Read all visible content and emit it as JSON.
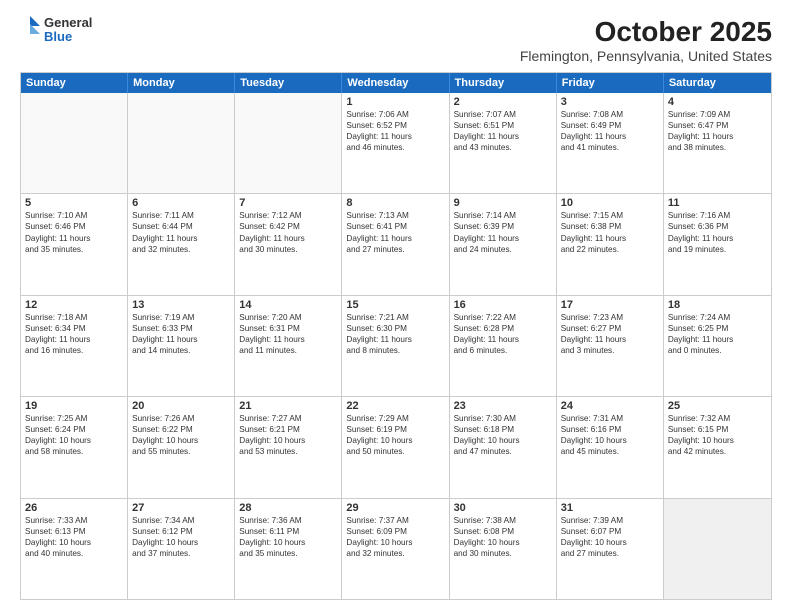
{
  "logo": {
    "general": "General",
    "blue": "Blue"
  },
  "title": "October 2025",
  "subtitle": "Flemington, Pennsylvania, United States",
  "days": [
    "Sunday",
    "Monday",
    "Tuesday",
    "Wednesday",
    "Thursday",
    "Friday",
    "Saturday"
  ],
  "rows": [
    [
      {
        "day": "",
        "empty": true
      },
      {
        "day": "",
        "empty": true
      },
      {
        "day": "",
        "empty": true
      },
      {
        "day": "1",
        "lines": [
          "Sunrise: 7:06 AM",
          "Sunset: 6:52 PM",
          "Daylight: 11 hours",
          "and 46 minutes."
        ]
      },
      {
        "day": "2",
        "lines": [
          "Sunrise: 7:07 AM",
          "Sunset: 6:51 PM",
          "Daylight: 11 hours",
          "and 43 minutes."
        ]
      },
      {
        "day": "3",
        "lines": [
          "Sunrise: 7:08 AM",
          "Sunset: 6:49 PM",
          "Daylight: 11 hours",
          "and 41 minutes."
        ]
      },
      {
        "day": "4",
        "lines": [
          "Sunrise: 7:09 AM",
          "Sunset: 6:47 PM",
          "Daylight: 11 hours",
          "and 38 minutes."
        ]
      }
    ],
    [
      {
        "day": "5",
        "lines": [
          "Sunrise: 7:10 AM",
          "Sunset: 6:46 PM",
          "Daylight: 11 hours",
          "and 35 minutes."
        ]
      },
      {
        "day": "6",
        "lines": [
          "Sunrise: 7:11 AM",
          "Sunset: 6:44 PM",
          "Daylight: 11 hours",
          "and 32 minutes."
        ]
      },
      {
        "day": "7",
        "lines": [
          "Sunrise: 7:12 AM",
          "Sunset: 6:42 PM",
          "Daylight: 11 hours",
          "and 30 minutes."
        ]
      },
      {
        "day": "8",
        "lines": [
          "Sunrise: 7:13 AM",
          "Sunset: 6:41 PM",
          "Daylight: 11 hours",
          "and 27 minutes."
        ]
      },
      {
        "day": "9",
        "lines": [
          "Sunrise: 7:14 AM",
          "Sunset: 6:39 PM",
          "Daylight: 11 hours",
          "and 24 minutes."
        ]
      },
      {
        "day": "10",
        "lines": [
          "Sunrise: 7:15 AM",
          "Sunset: 6:38 PM",
          "Daylight: 11 hours",
          "and 22 minutes."
        ]
      },
      {
        "day": "11",
        "lines": [
          "Sunrise: 7:16 AM",
          "Sunset: 6:36 PM",
          "Daylight: 11 hours",
          "and 19 minutes."
        ]
      }
    ],
    [
      {
        "day": "12",
        "lines": [
          "Sunrise: 7:18 AM",
          "Sunset: 6:34 PM",
          "Daylight: 11 hours",
          "and 16 minutes."
        ]
      },
      {
        "day": "13",
        "lines": [
          "Sunrise: 7:19 AM",
          "Sunset: 6:33 PM",
          "Daylight: 11 hours",
          "and 14 minutes."
        ]
      },
      {
        "day": "14",
        "lines": [
          "Sunrise: 7:20 AM",
          "Sunset: 6:31 PM",
          "Daylight: 11 hours",
          "and 11 minutes."
        ]
      },
      {
        "day": "15",
        "lines": [
          "Sunrise: 7:21 AM",
          "Sunset: 6:30 PM",
          "Daylight: 11 hours",
          "and 8 minutes."
        ]
      },
      {
        "day": "16",
        "lines": [
          "Sunrise: 7:22 AM",
          "Sunset: 6:28 PM",
          "Daylight: 11 hours",
          "and 6 minutes."
        ]
      },
      {
        "day": "17",
        "lines": [
          "Sunrise: 7:23 AM",
          "Sunset: 6:27 PM",
          "Daylight: 11 hours",
          "and 3 minutes."
        ]
      },
      {
        "day": "18",
        "lines": [
          "Sunrise: 7:24 AM",
          "Sunset: 6:25 PM",
          "Daylight: 11 hours",
          "and 0 minutes."
        ]
      }
    ],
    [
      {
        "day": "19",
        "lines": [
          "Sunrise: 7:25 AM",
          "Sunset: 6:24 PM",
          "Daylight: 10 hours",
          "and 58 minutes."
        ]
      },
      {
        "day": "20",
        "lines": [
          "Sunrise: 7:26 AM",
          "Sunset: 6:22 PM",
          "Daylight: 10 hours",
          "and 55 minutes."
        ]
      },
      {
        "day": "21",
        "lines": [
          "Sunrise: 7:27 AM",
          "Sunset: 6:21 PM",
          "Daylight: 10 hours",
          "and 53 minutes."
        ]
      },
      {
        "day": "22",
        "lines": [
          "Sunrise: 7:29 AM",
          "Sunset: 6:19 PM",
          "Daylight: 10 hours",
          "and 50 minutes."
        ]
      },
      {
        "day": "23",
        "lines": [
          "Sunrise: 7:30 AM",
          "Sunset: 6:18 PM",
          "Daylight: 10 hours",
          "and 47 minutes."
        ]
      },
      {
        "day": "24",
        "lines": [
          "Sunrise: 7:31 AM",
          "Sunset: 6:16 PM",
          "Daylight: 10 hours",
          "and 45 minutes."
        ]
      },
      {
        "day": "25",
        "lines": [
          "Sunrise: 7:32 AM",
          "Sunset: 6:15 PM",
          "Daylight: 10 hours",
          "and 42 minutes."
        ]
      }
    ],
    [
      {
        "day": "26",
        "lines": [
          "Sunrise: 7:33 AM",
          "Sunset: 6:13 PM",
          "Daylight: 10 hours",
          "and 40 minutes."
        ]
      },
      {
        "day": "27",
        "lines": [
          "Sunrise: 7:34 AM",
          "Sunset: 6:12 PM",
          "Daylight: 10 hours",
          "and 37 minutes."
        ]
      },
      {
        "day": "28",
        "lines": [
          "Sunrise: 7:36 AM",
          "Sunset: 6:11 PM",
          "Daylight: 10 hours",
          "and 35 minutes."
        ]
      },
      {
        "day": "29",
        "lines": [
          "Sunrise: 7:37 AM",
          "Sunset: 6:09 PM",
          "Daylight: 10 hours",
          "and 32 minutes."
        ]
      },
      {
        "day": "30",
        "lines": [
          "Sunrise: 7:38 AM",
          "Sunset: 6:08 PM",
          "Daylight: 10 hours",
          "and 30 minutes."
        ]
      },
      {
        "day": "31",
        "lines": [
          "Sunrise: 7:39 AM",
          "Sunset: 6:07 PM",
          "Daylight: 10 hours",
          "and 27 minutes."
        ]
      },
      {
        "day": "",
        "empty": true,
        "shaded": true
      }
    ]
  ]
}
